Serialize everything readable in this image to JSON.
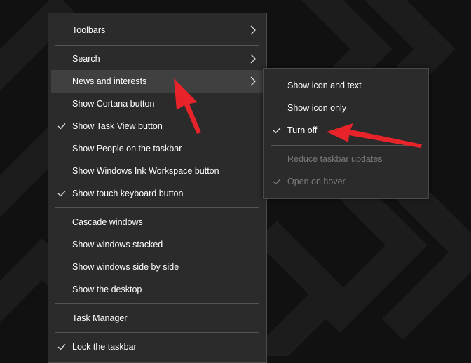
{
  "colors": {
    "menu_bg": "#2b2b2b",
    "hover_bg": "#404040",
    "disabled_text": "#7a7a7a",
    "annotation": "#e8242a"
  },
  "main_menu": {
    "toolbars": "Toolbars",
    "search": "Search",
    "news_and_interests": "News and interests",
    "show_cortana": "Show Cortana button",
    "show_task_view": "Show Task View button",
    "show_people": "Show People on the taskbar",
    "show_ink": "Show Windows Ink Workspace button",
    "show_touch_keyboard": "Show touch keyboard button",
    "cascade": "Cascade windows",
    "stacked": "Show windows stacked",
    "side_by_side": "Show windows side by side",
    "desktop": "Show the desktop",
    "task_manager": "Task Manager",
    "lock_taskbar": "Lock the taskbar"
  },
  "sub_menu": {
    "icon_and_text": "Show icon and text",
    "icon_only": "Show icon only",
    "turn_off": "Turn off",
    "reduce_updates": "Reduce taskbar updates",
    "open_on_hover": "Open on hover"
  },
  "icons": {
    "check": "check-icon",
    "chevron": "chevron-right-icon",
    "annotation": "red-arrow-icon"
  }
}
